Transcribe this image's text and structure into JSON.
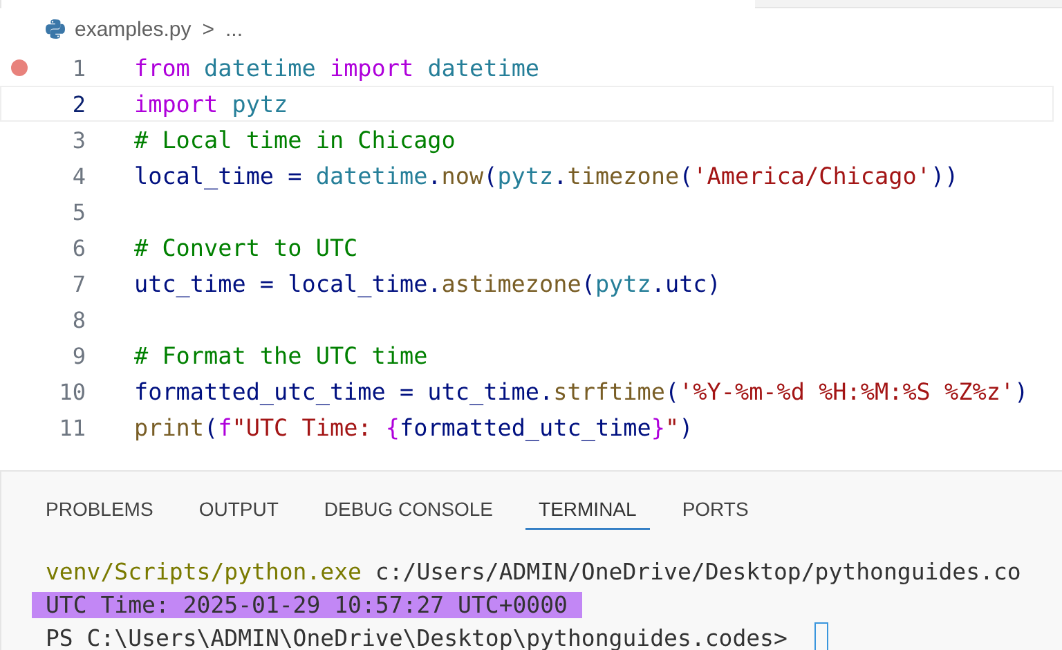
{
  "breadcrumb": {
    "file": "examples.py",
    "separator": ">",
    "more": "..."
  },
  "editor": {
    "lines": [
      {
        "number": "1",
        "breakpoint": true,
        "current": false,
        "tokens": [
          {
            "kind": "kw",
            "text": "from "
          },
          {
            "kind": "mod",
            "text": "datetime "
          },
          {
            "kind": "kw",
            "text": "import "
          },
          {
            "kind": "mod",
            "text": "datetime"
          }
        ]
      },
      {
        "number": "2",
        "breakpoint": false,
        "current": true,
        "tokens": [
          {
            "kind": "kw",
            "text": "import "
          },
          {
            "kind": "mod",
            "text": "pytz"
          }
        ]
      },
      {
        "number": "3",
        "breakpoint": false,
        "current": false,
        "tokens": [
          {
            "kind": "cmt",
            "text": "# Local time in Chicago"
          }
        ]
      },
      {
        "number": "4",
        "breakpoint": false,
        "current": false,
        "tokens": [
          {
            "kind": "id",
            "text": "local_time = "
          },
          {
            "kind": "mod",
            "text": "datetime"
          },
          {
            "kind": "id",
            "text": "."
          },
          {
            "kind": "fn",
            "text": "now"
          },
          {
            "kind": "id",
            "text": "("
          },
          {
            "kind": "mod",
            "text": "pytz"
          },
          {
            "kind": "id",
            "text": "."
          },
          {
            "kind": "fn",
            "text": "timezone"
          },
          {
            "kind": "id",
            "text": "("
          },
          {
            "kind": "str",
            "text": "'America/Chicago'"
          },
          {
            "kind": "id",
            "text": "))"
          }
        ]
      },
      {
        "number": "5",
        "breakpoint": false,
        "current": false
      },
      {
        "number": "6",
        "breakpoint": false,
        "current": false,
        "tokens": [
          {
            "kind": "cmt",
            "text": "# Convert to UTC"
          }
        ]
      },
      {
        "number": "7",
        "breakpoint": false,
        "current": false,
        "tokens": [
          {
            "kind": "id",
            "text": "utc_time = local_time."
          },
          {
            "kind": "fn",
            "text": "astimezone"
          },
          {
            "kind": "id",
            "text": "("
          },
          {
            "kind": "mod",
            "text": "pytz"
          },
          {
            "kind": "id",
            "text": ".utc)"
          }
        ]
      },
      {
        "number": "8",
        "breakpoint": false,
        "current": false
      },
      {
        "number": "9",
        "breakpoint": false,
        "current": false,
        "tokens": [
          {
            "kind": "cmt",
            "text": "# Format the UTC time"
          }
        ]
      },
      {
        "number": "10",
        "breakpoint": false,
        "current": false,
        "tokens": [
          {
            "kind": "id",
            "text": "formatted_utc_time = utc_time."
          },
          {
            "kind": "fn",
            "text": "strftime"
          },
          {
            "kind": "id",
            "text": "("
          },
          {
            "kind": "str",
            "text": "'%Y-%m-%d %H:%M:%S %Z%z'"
          },
          {
            "kind": "id",
            "text": ")"
          }
        ]
      },
      {
        "number": "11",
        "breakpoint": false,
        "current": false,
        "tokens": [
          {
            "kind": "fn",
            "text": "print"
          },
          {
            "kind": "id",
            "text": "("
          },
          {
            "kind": "kw",
            "text": "f"
          },
          {
            "kind": "str",
            "text": "\"UTC Time: "
          },
          {
            "kind": "kw",
            "text": "{"
          },
          {
            "kind": "id",
            "text": "formatted_utc_time"
          },
          {
            "kind": "kw",
            "text": "}"
          },
          {
            "kind": "str",
            "text": "\""
          },
          {
            "kind": "id",
            "text": ")"
          }
        ]
      }
    ]
  },
  "panel": {
    "tabs": [
      {
        "label": "PROBLEMS",
        "selected": false
      },
      {
        "label": "OUTPUT",
        "selected": false
      },
      {
        "label": "DEBUG CONSOLE",
        "selected": false
      },
      {
        "label": "TERMINAL",
        "selected": true
      },
      {
        "label": "PORTS",
        "selected": false
      }
    ],
    "terminal": [
      {
        "highlighted": false,
        "cursor": false,
        "tokens": [
          {
            "kind": "exe",
            "text": "venv/Scripts/python.exe"
          },
          {
            "kind": "plain",
            "text": " c:/Users/ADMIN/OneDrive/Desktop/pythonguides.co"
          }
        ]
      },
      {
        "highlighted": true,
        "cursor": false,
        "tokens": [
          {
            "kind": "plain",
            "text": "UTC Time: 2025-01-29 10:57:27 UTC+0000"
          }
        ]
      },
      {
        "highlighted": false,
        "cursor": true,
        "tokens": [
          {
            "kind": "plain",
            "text": "PS C:\\Users\\ADMIN\\OneDrive\\Desktop\\pythonguides.codes>"
          }
        ]
      }
    ]
  }
}
